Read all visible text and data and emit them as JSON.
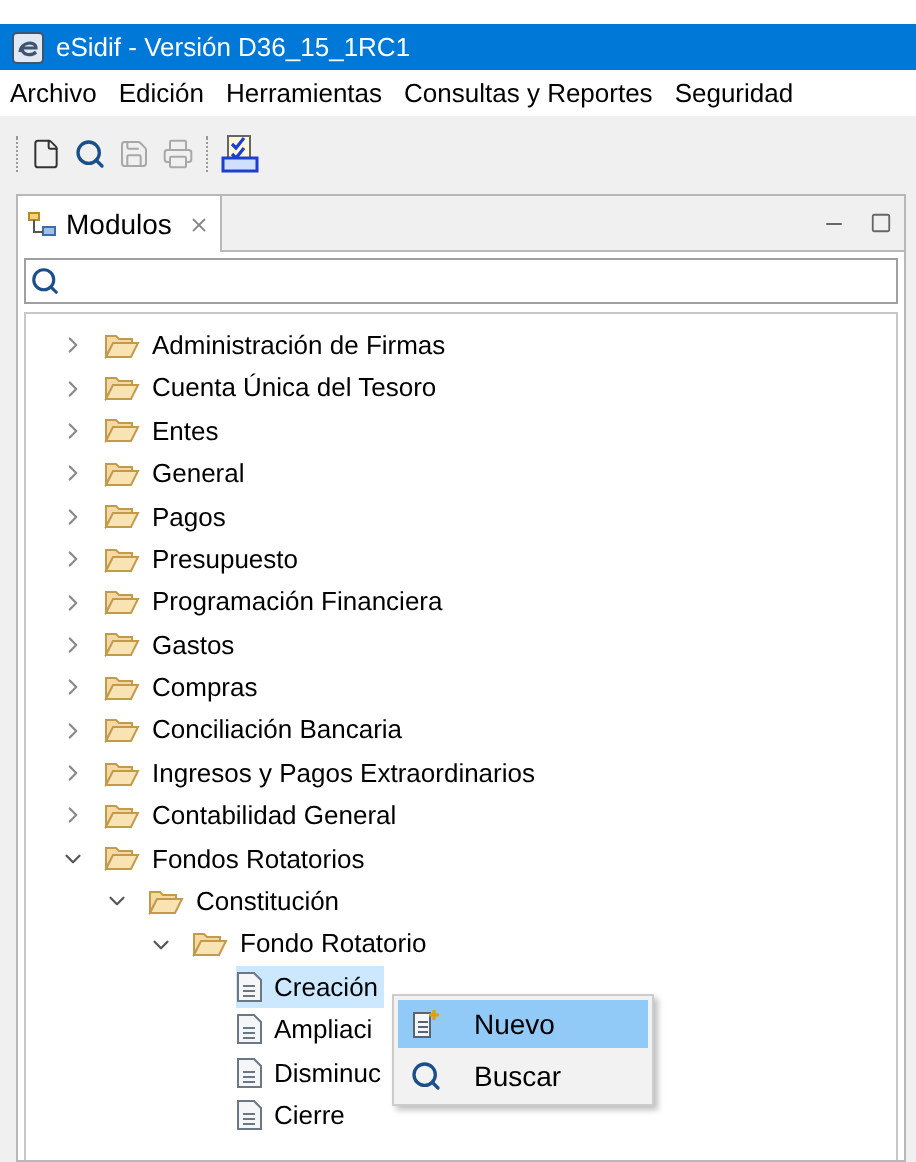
{
  "window": {
    "title": "eSidif - Versión D36_15_1RC1"
  },
  "menu": [
    "Archivo",
    "Edición",
    "Herramientas",
    "Consultas y Reportes",
    "Seguridad"
  ],
  "toolbar": [
    {
      "kind": "new",
      "disabled": false
    },
    {
      "kind": "search",
      "disabled": false
    },
    {
      "kind": "save",
      "disabled": true
    },
    {
      "kind": "print",
      "disabled": true
    },
    {
      "kind": "check",
      "disabled": false
    }
  ],
  "view": {
    "tab": {
      "label": "Modulos"
    },
    "tree": [
      {
        "label": "Administración de Firmas",
        "kind": "folder",
        "expanded": false
      },
      {
        "label": "Cuenta Única del Tesoro",
        "kind": "folder",
        "expanded": false
      },
      {
        "label": "Entes",
        "kind": "folder",
        "expanded": false
      },
      {
        "label": "General",
        "kind": "folder",
        "expanded": false
      },
      {
        "label": "Pagos",
        "kind": "folder",
        "expanded": false
      },
      {
        "label": "Presupuesto",
        "kind": "folder",
        "expanded": false
      },
      {
        "label": "Programación Financiera",
        "kind": "folder",
        "expanded": false
      },
      {
        "label": "Gastos",
        "kind": "folder",
        "expanded": false
      },
      {
        "label": "Compras",
        "kind": "folder",
        "expanded": false
      },
      {
        "label": "Conciliación Bancaria",
        "kind": "folder",
        "expanded": false
      },
      {
        "label": "Ingresos y Pagos Extraordinarios",
        "kind": "folder",
        "expanded": false
      },
      {
        "label": "Contabilidad General",
        "kind": "folder",
        "expanded": false
      },
      {
        "label": "Fondos Rotatorios",
        "kind": "folder",
        "expanded": true,
        "children": [
          {
            "label": "Constitución",
            "kind": "folder",
            "expanded": true,
            "children": [
              {
                "label": "Fondo Rotatorio",
                "kind": "folder",
                "expanded": true,
                "children": [
                  {
                    "label": "Creación",
                    "kind": "file",
                    "selected": true
                  },
                  {
                    "label": "Ampliaci",
                    "kind": "file",
                    "selected": false
                  },
                  {
                    "label": "Disminuc",
                    "kind": "file",
                    "selected": false
                  },
                  {
                    "label": "Cierre",
                    "kind": "file",
                    "selected": false
                  }
                ]
              }
            ]
          }
        ]
      }
    ]
  },
  "context_menu": [
    {
      "label": "Nuevo",
      "kind": "new",
      "selected": true
    },
    {
      "label": "Buscar",
      "kind": "search",
      "selected": false
    }
  ]
}
